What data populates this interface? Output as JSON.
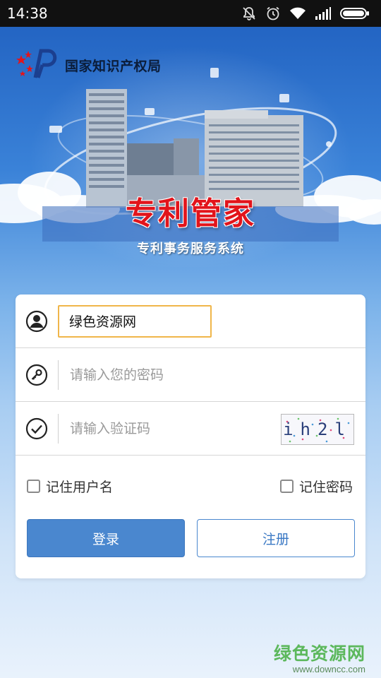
{
  "status_bar": {
    "time": "14:38",
    "icons": [
      "mute-icon",
      "alarm-icon",
      "wifi-icon",
      "signal-icon",
      "battery-icon"
    ]
  },
  "hero": {
    "logo_text": "国家知识产权局",
    "title": "专利管家",
    "subtitle": "专利事务服务系统"
  },
  "login": {
    "username_value": "绿色资源网",
    "password_placeholder": "请输入您的密码",
    "captcha_placeholder": "请输入验证码",
    "captcha_text": "ih2l",
    "remember_username_label": "记住用户名",
    "remember_password_label": "记住密码",
    "login_button": "登录",
    "register_button": "注册",
    "remember_username_checked": false,
    "remember_password_checked": false
  },
  "watermark": {
    "title": "绿色资源网",
    "url": "www.downcc.com"
  },
  "colors": {
    "accent": "#4a87cf",
    "title_red": "#e2141b",
    "input_focus": "#f0b64a",
    "watermark_green": "#5cb85c"
  }
}
